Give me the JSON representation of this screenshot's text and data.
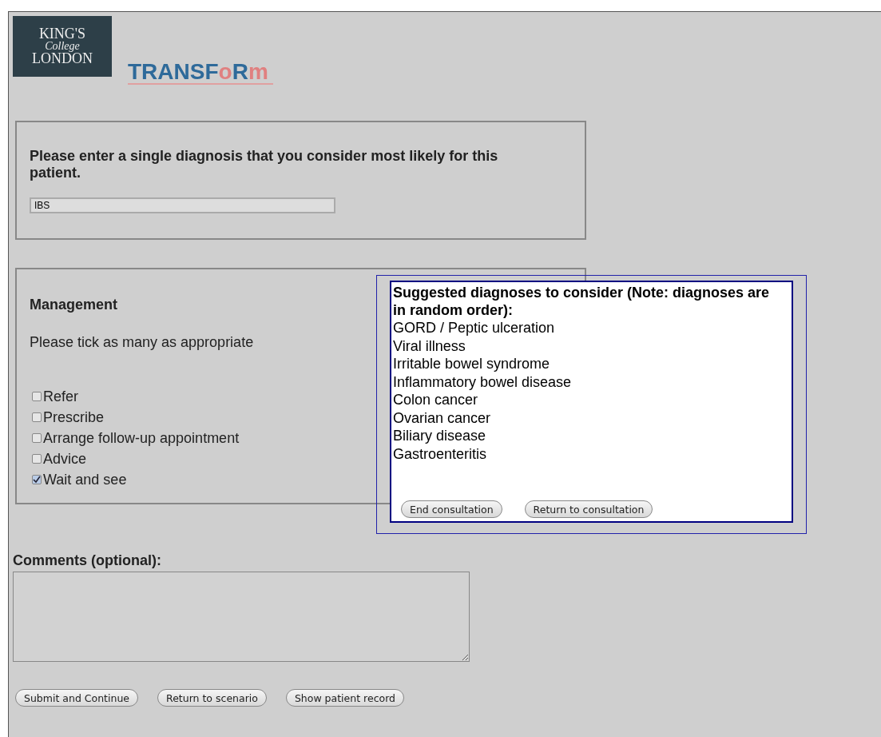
{
  "header": {
    "logo_lines": [
      "KING'S",
      "College",
      "LONDON"
    ],
    "project_name": [
      {
        "text": "TRANSF",
        "color": "#2e6a9a"
      },
      {
        "text": "o",
        "color": "#e08080"
      },
      {
        "text": "R",
        "color": "#2e6a9a"
      },
      {
        "text": "m",
        "color": "#e08080"
      }
    ]
  },
  "diagnosis": {
    "question": "Please enter a single diagnosis that you consider most likely for this patient.",
    "value": "IBS"
  },
  "management": {
    "title": "Management",
    "instruction": "Please tick as many as appropriate",
    "options": [
      {
        "label": "Refer",
        "checked": false
      },
      {
        "label": "Prescribe",
        "checked": false
      },
      {
        "label": "Arrange follow-up appointment",
        "checked": false
      },
      {
        "label": "Advice",
        "checked": false
      },
      {
        "label": "Wait and see",
        "checked": true
      }
    ]
  },
  "suggestions": {
    "title": "Suggested diagnoses to consider (Note: diagnoses are in random order):",
    "items": [
      "GORD / Peptic ulceration",
      "Viral illness",
      "Irritable bowel syndrome",
      "Inflammatory bowel disease",
      "Colon cancer",
      "Ovarian cancer",
      "Biliary disease",
      "Gastroenteritis"
    ],
    "buttons": [
      "End consultation",
      "Return to consultation"
    ]
  },
  "comments": {
    "label": "Comments (optional):"
  },
  "buttons": [
    "Submit and Continue",
    "Return to scenario",
    "Show patient record"
  ]
}
